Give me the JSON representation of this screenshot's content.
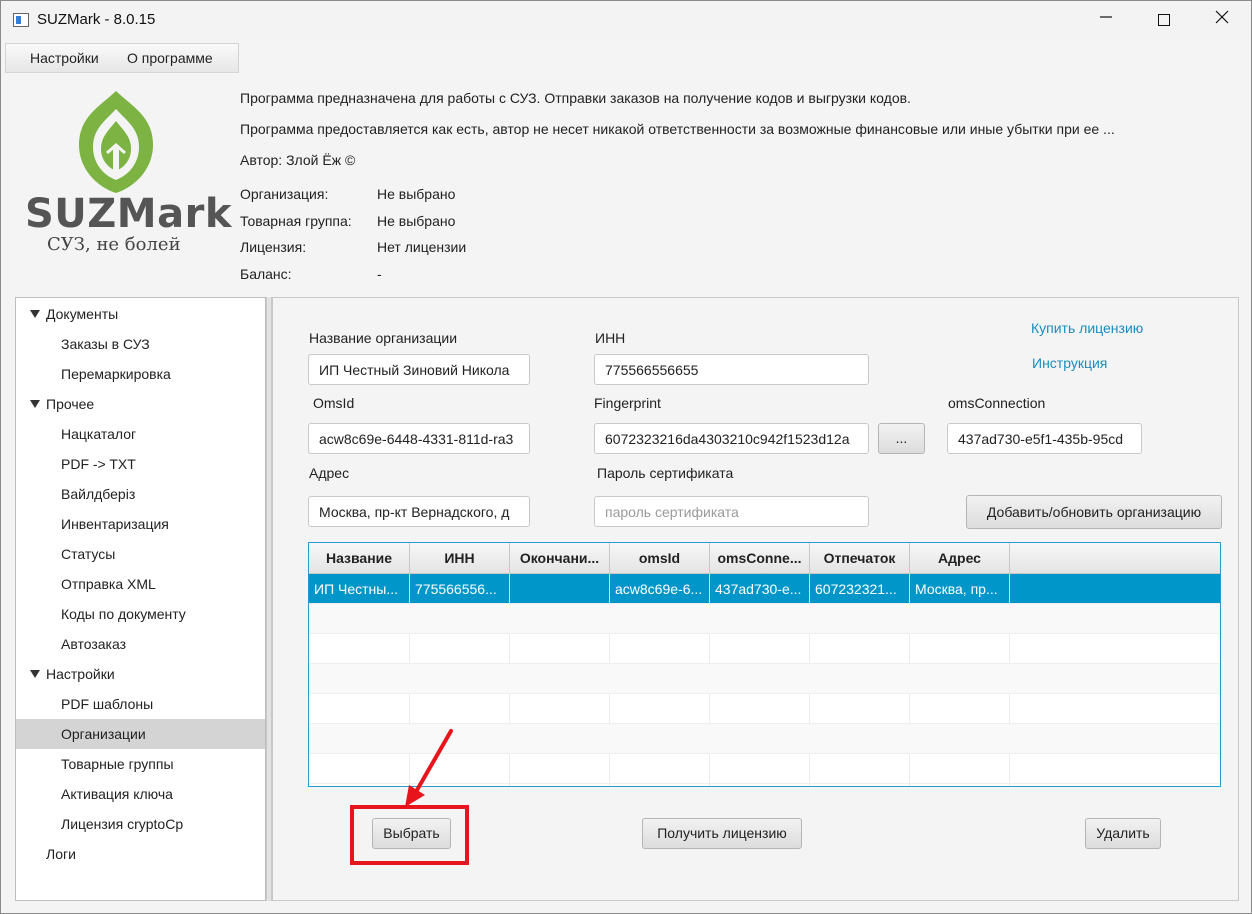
{
  "window": {
    "title": "SUZMark - 8.0.15"
  },
  "menu": {
    "settings": "Настройки",
    "about": "О программе"
  },
  "logo": {
    "brand": "SUZMark",
    "tagline": "СУЗ, не болей"
  },
  "info": {
    "description1": "Программа предназначена для работы с СУЗ. Отправки заказов на получение кодов и выгрузки кодов.",
    "description2": "Программа предоставляется как есть, автор не несет никакой ответственности за возможные финансовые или иные убытки при ее ...",
    "author": "Автор: Злой Ёж ©",
    "org_label": "Организация:",
    "org_value": "Не выбрано",
    "group_label": "Товарная группа:",
    "group_value": "Не выбрано",
    "license_label": "Лицензия:",
    "license_value": "Нет лицензии",
    "balance_label": "Баланс:",
    "balance_value": "-"
  },
  "sidebar": {
    "documents": "Документы",
    "orders": "Заказы в СУЗ",
    "remark": "Перемаркировка",
    "other": "Прочее",
    "natcatalog": "Нацкаталог",
    "pdf_txt": "PDF -> TXT",
    "wildberries": "Вайлдберiз",
    "inventory": "Инвентаризация",
    "statuses": "Статусы",
    "send_xml": "Отправка XML",
    "codes_doc": "Коды по документу",
    "autoorder": "Автозаказ",
    "settings": "Настройки",
    "pdf_templates": "PDF шаблоны",
    "organizations": "Организации",
    "product_groups": "Товарные группы",
    "key_activation": "Активация ключа",
    "license_crypto": "Лицензия cryptoCp",
    "logs": "Логи"
  },
  "form": {
    "org_name_label": "Название организации",
    "org_name_value": "ИП Честный Зиновий Никола",
    "inn_label": "ИНН",
    "inn_value": "775566556655",
    "omsid_label": "OmsId",
    "omsid_value": "acw8c69e-6448-4331-811d-ra3",
    "fingerprint_label": "Fingerprint",
    "fingerprint_value": "6072323216da4303210c942f1523d12a",
    "browse_label": "...",
    "omsconn_label": "omsConnection",
    "omsconn_value": "437ad730-e5f1-435b-95cd",
    "address_label": "Адрес",
    "address_value": "Москва, пр-кт Вернадского, д",
    "cert_pass_label": "Пароль сертификата",
    "cert_pass_placeholder": "пароль сертификата",
    "add_update_button": "Добавить/обновить организацию",
    "buy_license_link": "Купить лицензию",
    "instruction_link": "Инструкция"
  },
  "table": {
    "columns": [
      "Название",
      "ИНН",
      "Окончани...",
      "omsId",
      "omsConne...",
      "Отпечаток",
      "Адрес"
    ],
    "rows": [
      [
        "ИП Честны...",
        "775566556...",
        "",
        "acw8c69e-6...",
        "437ad730-e...",
        "607232321...",
        "Москва, пр..."
      ]
    ]
  },
  "actions": {
    "select_button": "Выбрать",
    "get_license_button": "Получить лицензию",
    "delete_button": "Удалить"
  },
  "colors": {
    "accent": "#0096c9",
    "link": "#1a8dc0",
    "annotation": "#e8141b",
    "logo_green": "#7cb342"
  }
}
